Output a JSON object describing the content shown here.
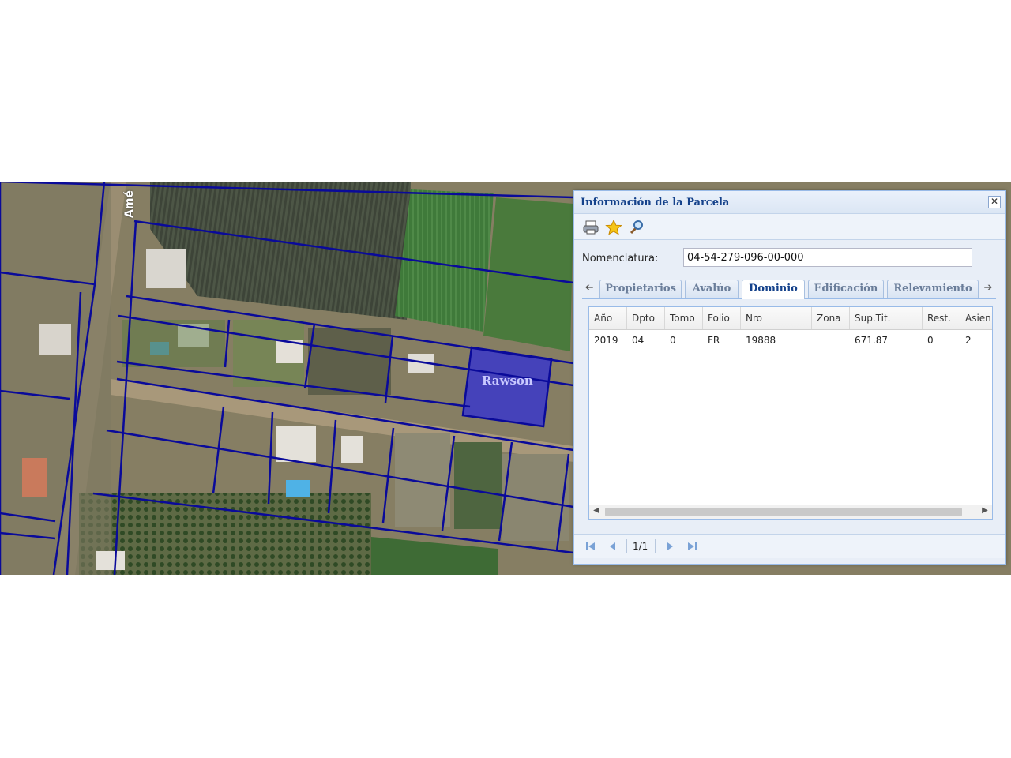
{
  "map": {
    "parcel_label": "Rawson",
    "road_label": "Amé"
  },
  "panel": {
    "title": "Información de la Parcela",
    "close_glyph": "✕",
    "toolbar": {
      "print_icon": "printer-icon",
      "favorite_icon": "star-icon",
      "zoom_icon": "magnifier-icon"
    },
    "nomenclatura_label": "Nomenclatura:",
    "nomenclatura_value": "04-54-279-096-00-000",
    "tabs": [
      {
        "label": "Propietarios",
        "active": false
      },
      {
        "label": "Avalúo",
        "active": false
      },
      {
        "label": "Dominio",
        "active": true
      },
      {
        "label": "Edificación",
        "active": false
      },
      {
        "label": "Relevamiento",
        "active": false
      }
    ],
    "grid": {
      "columns": [
        "Año",
        "Dpto",
        "Tomo",
        "Folio",
        "Nro",
        "Zona",
        "Sup.Tit.",
        "Rest.",
        "Asien"
      ],
      "rows": [
        [
          "2019",
          "04",
          "0",
          "FR",
          "19888",
          "",
          "671.87",
          "0",
          "2"
        ]
      ]
    },
    "pager": {
      "page_text": "1/1"
    }
  },
  "colors": {
    "panel_title": "#15428b",
    "parcel_line": "#0a0a9a",
    "selected_parcel": "#2a2ae0"
  }
}
